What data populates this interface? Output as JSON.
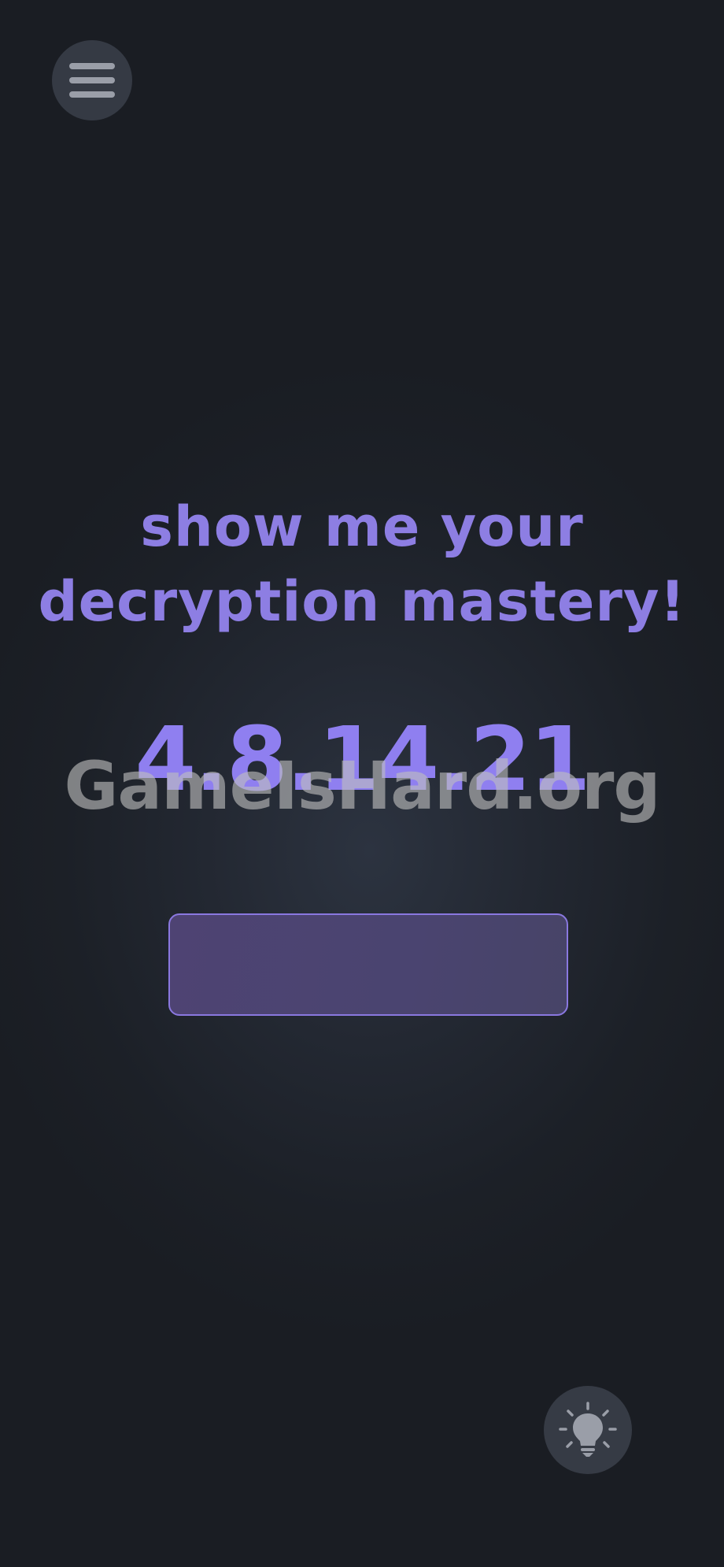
{
  "menu": {
    "icon": "hamburger-menu-icon"
  },
  "puzzle": {
    "prompt_line1": "show me your",
    "prompt_line2": "decryption mastery!",
    "code": "4.8.14.21"
  },
  "watermark": {
    "text": "GameIsHard.org"
  },
  "answer": {
    "value": "",
    "placeholder": ""
  },
  "hint": {
    "icon": "lightbulb-icon"
  },
  "colors": {
    "accent": "#8f7ff0",
    "background": "#1b1e24",
    "button_bg": "#353a44",
    "icon": "#9a9ea8"
  }
}
